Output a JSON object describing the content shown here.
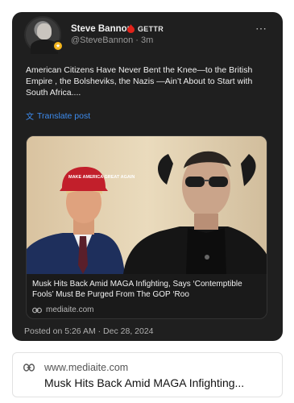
{
  "post": {
    "author": {
      "display_name": "Steve Bannon",
      "verified_icon": "verified-badge-icon",
      "platform": "GETTR",
      "handle_and_time": "@SteveBannon · 3m"
    },
    "more_icon": "⋯",
    "text": "American Citizens Have Never Bent the Knee—to the British Empire , the Bolsheviks, the Nazis —Ain’t About to Start with South Africa....",
    "translate_label": "Translate post",
    "link_card": {
      "title": "Musk Hits Back Amid MAGA Infighting, Says ‘Contemptible Fools’ Must Be Purged From The GOP ‘Roo",
      "domain": "mediaite.com",
      "image_hat_text": "MAKE AMERICA GREAT AGAIN"
    },
    "timestamp": "Posted on 5:26 AM · Dec 28, 2024"
  },
  "preview": {
    "domain": "www.mediaite.com",
    "title": "Musk Hits Back Amid MAGA Infighting..."
  },
  "colors": {
    "card_bg": "#1f1f1f",
    "link_blue": "#3d8cf0",
    "verified_red": "#e2231a"
  }
}
